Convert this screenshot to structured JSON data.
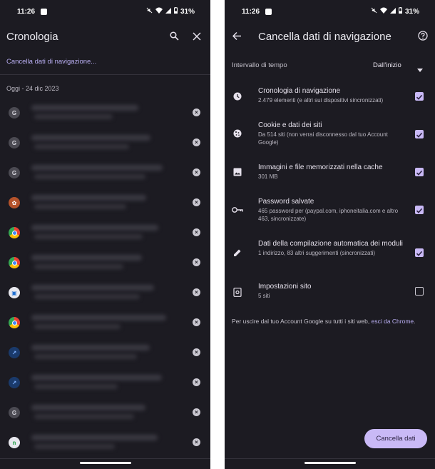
{
  "status_bar": {
    "time": "11:26",
    "battery": "31%"
  },
  "history": {
    "title": "Cronologia",
    "clear_link": "Cancella dati di navigazione...",
    "date_header": "Oggi - 24 dic 2023",
    "favicons": [
      "G",
      "G",
      "G",
      "hippo",
      "chrome",
      "chrome",
      "m",
      "chrome",
      "chart",
      "chart",
      "G",
      "n"
    ]
  },
  "clear_data": {
    "title": "Cancella dati di navigazione",
    "time_range_label": "Intervallo di tempo",
    "time_range_value": "Dall'inizio",
    "options": [
      {
        "icon": "clock-icon",
        "title": "Cronologia di navigazione",
        "subtitle": "2.479 elementi (e altri sui dispositivi sincronizzati)",
        "checked": true
      },
      {
        "icon": "cookie-icon",
        "title": "Cookie e dati dei siti",
        "subtitle": "Da 514 siti (non verrai disconnesso dal tuo Account Google)",
        "checked": true
      },
      {
        "icon": "image-icon",
        "title": "Immagini e file memorizzati nella cache",
        "subtitle": "301 MB",
        "checked": true
      },
      {
        "icon": "key-icon",
        "title": "Password salvate",
        "subtitle": "465 password per (paypal.com, iphoneitalia.com e altro 463, sincronizzate)",
        "checked": true
      },
      {
        "icon": "pencil-icon",
        "title": "Dati della compilazione automatica dei moduli",
        "subtitle": "1 indirizzo, 83 altri suggerimenti (sincronizzati)",
        "checked": true
      },
      {
        "icon": "site-settings-icon",
        "title": "Impostazioni sito",
        "subtitle": "5 siti",
        "checked": false
      }
    ],
    "footer_text": "Per uscire dal tuo Account Google su tutti i siti web, ",
    "footer_link": "esci da Chrome",
    "footer_end": ".",
    "clear_button": "Cancella dati"
  }
}
